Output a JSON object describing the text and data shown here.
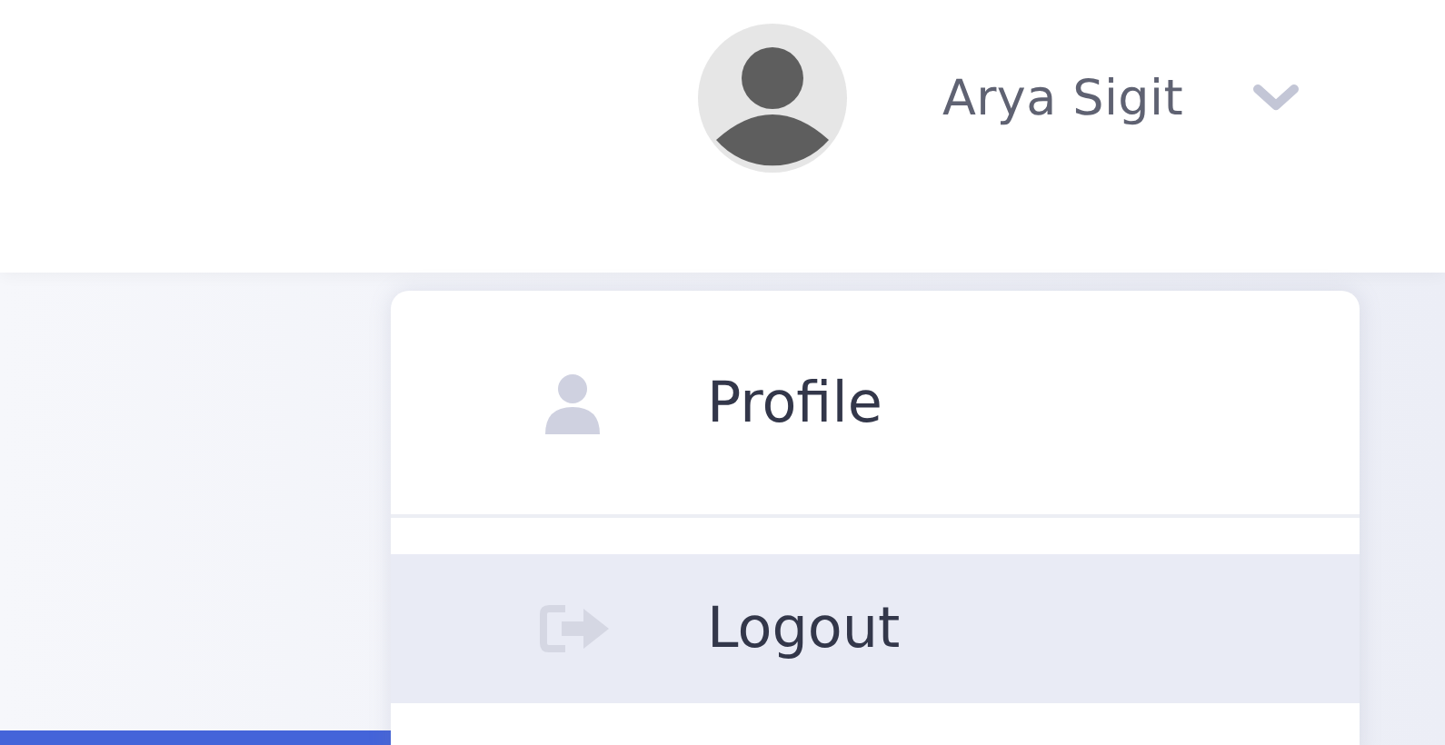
{
  "user": {
    "name": "Arya Sigit",
    "expanded": true
  },
  "menu": [
    {
      "kind": "profile",
      "label": "Profile",
      "selected": false
    },
    {
      "kind": "logout",
      "label": "Logout",
      "selected": true
    }
  ]
}
